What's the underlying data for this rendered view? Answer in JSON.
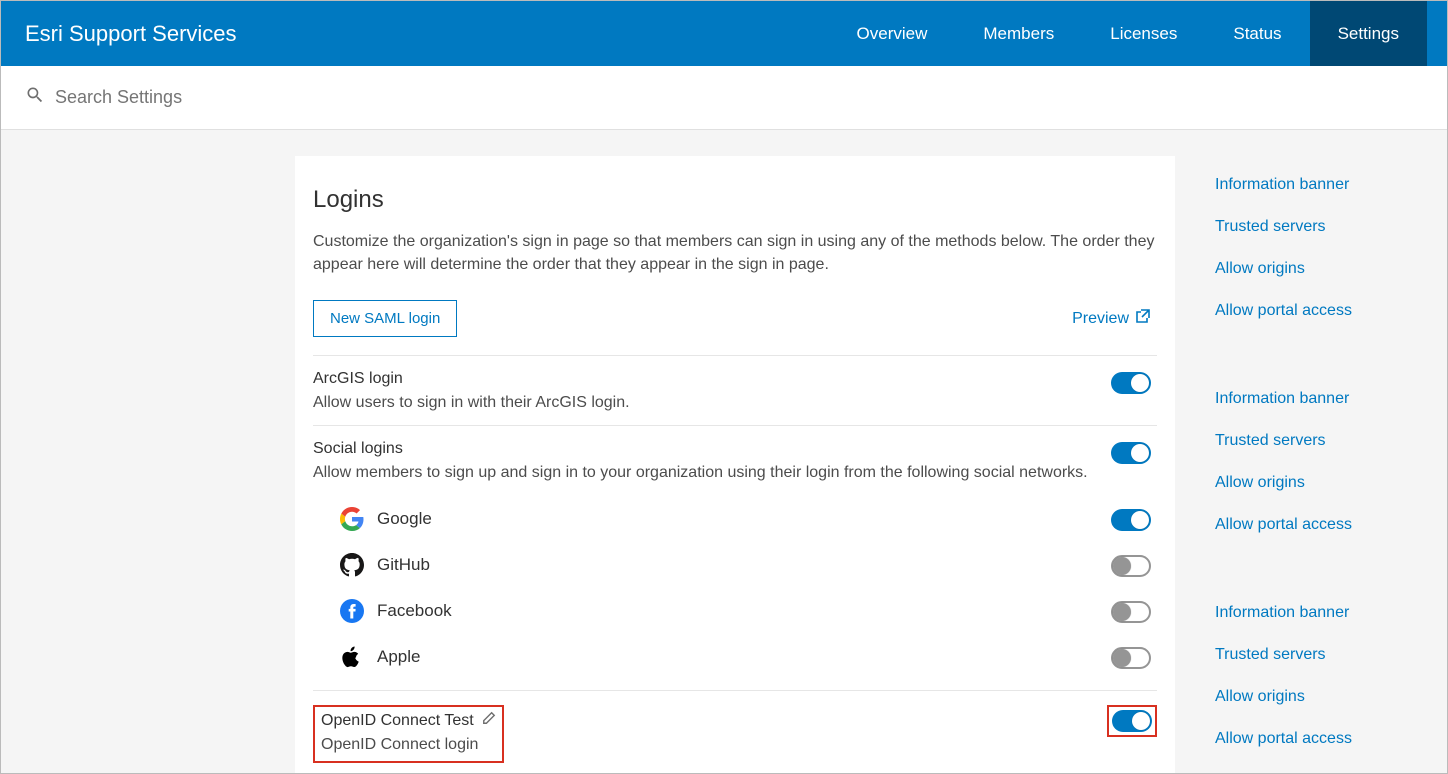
{
  "nav": {
    "brand": "Esri Support Services",
    "tabs": [
      "Overview",
      "Members",
      "Licenses",
      "Status",
      "Settings"
    ],
    "active": 4
  },
  "search": {
    "placeholder": "Search Settings"
  },
  "page": {
    "title": "Logins",
    "description": "Customize the organization's sign in page so that members can sign in using any of the methods below. The order they appear here will determine the order that they appear in the sign in page.",
    "new_saml_button": "New SAML login",
    "preview_label": "Preview"
  },
  "sections": {
    "arcgis": {
      "title": "ArcGIS login",
      "sub": "Allow users to sign in with their ArcGIS login.",
      "on": true
    },
    "social": {
      "title": "Social logins",
      "sub": "Allow members to sign up and sign in to your organization using their login from the following social networks.",
      "on": true,
      "providers": [
        {
          "name": "Google",
          "on": true
        },
        {
          "name": "GitHub",
          "on": false
        },
        {
          "name": "Facebook",
          "on": false
        },
        {
          "name": "Apple",
          "on": false
        }
      ]
    },
    "openid": {
      "title": "OpenID Connect Test",
      "sub": "OpenID Connect login",
      "on": true
    }
  },
  "sidelinks": [
    "Information banner",
    "Trusted servers",
    "Allow origins",
    "Allow portal access",
    "Information banner",
    "Trusted servers",
    "Allow origins",
    "Allow portal access",
    "Information banner",
    "Trusted servers",
    "Allow origins",
    "Allow portal access"
  ]
}
